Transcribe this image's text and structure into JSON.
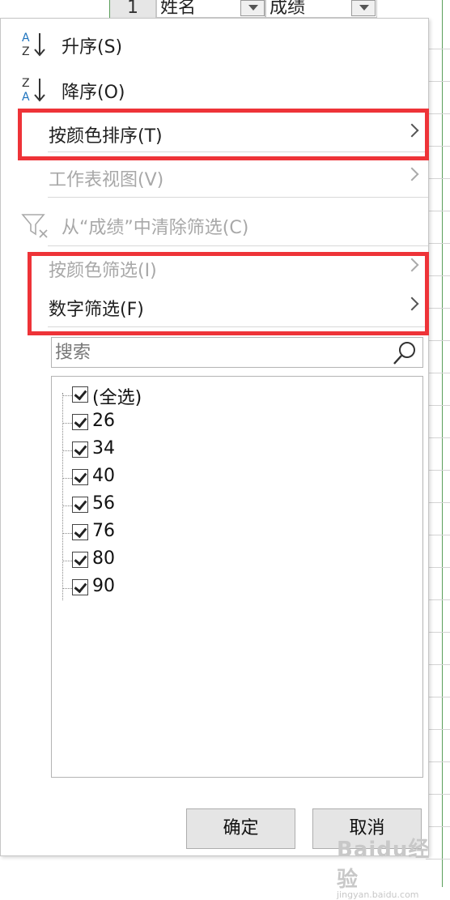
{
  "header": {
    "row_number": "1",
    "col1_text": "姓名",
    "col2_text": "成绩"
  },
  "menu": {
    "sort_asc": "升序(S)",
    "sort_desc": "降序(O)",
    "sort_by_color": "按颜色排序(T)",
    "sheet_view": "工作表视图(V)",
    "clear_filter": "从“成绩”中清除筛选(C)",
    "filter_by_color": "按颜色筛选(I)",
    "number_filter": "数字筛选(F)"
  },
  "search": {
    "placeholder": "搜索"
  },
  "list": {
    "items": [
      "(全选)",
      "26",
      "34",
      "40",
      "56",
      "76",
      "80",
      "90"
    ],
    "checked": [
      true,
      true,
      true,
      true,
      true,
      true,
      true,
      true
    ]
  },
  "buttons": {
    "ok": "确定",
    "cancel": "取消"
  },
  "watermark": {
    "text": "Baidu经验",
    "sub": "jingyan.baidu.com"
  },
  "colors": {
    "highlight_box": "#ee3338",
    "sort_icon_blue": "#1e73be",
    "disabled_text": "#a8a8a8"
  }
}
